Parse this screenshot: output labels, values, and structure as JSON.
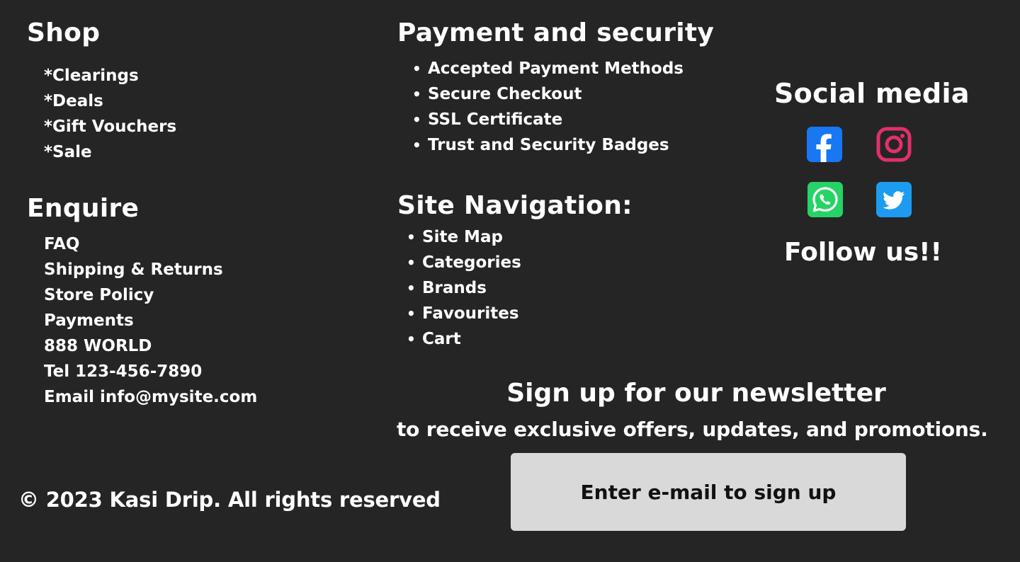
{
  "shop": {
    "heading": "Shop",
    "items": [
      "*Clearings",
      "*Deals",
      "*Gift Vouchers",
      "*Sale"
    ]
  },
  "enquire": {
    "heading": "Enquire",
    "items": [
      "FAQ",
      "Shipping & Returns",
      "Store Policy",
      "Payments",
      "888 WORLD",
      "Tel 123-456-7890",
      "Email info@mysite.com"
    ]
  },
  "payment": {
    "heading": "Payment and security",
    "items": [
      "Accepted Payment Methods",
      "Secure Checkout",
      "SSL Certificate",
      "Trust and Security Badges"
    ]
  },
  "site_nav": {
    "heading": "Site Navigation:",
    "items": [
      "Site Map",
      "Categories",
      "Brands",
      "Favourites",
      "Cart"
    ]
  },
  "social": {
    "heading": "Social media",
    "icons": [
      {
        "name": "facebook-icon",
        "color": "#1877f2"
      },
      {
        "name": "instagram-icon",
        "color": "#e1306c"
      },
      {
        "name": "whatsapp-icon",
        "color": "#25d366"
      },
      {
        "name": "twitter-icon",
        "color": "#1d9bf0"
      }
    ],
    "follow_text": "Follow us!!"
  },
  "newsletter": {
    "title": "Sign up for our newsletter",
    "subtitle": "to receive exclusive offers, updates, and promotions.",
    "button_label": "Enter e-mail to sign up"
  },
  "footer": {
    "copyright": "© 2023 Kasi Drip. All rights reserved"
  },
  "colors": {
    "background": "#252525",
    "text": "#ffffff",
    "button_bg": "#d9d9d9"
  }
}
